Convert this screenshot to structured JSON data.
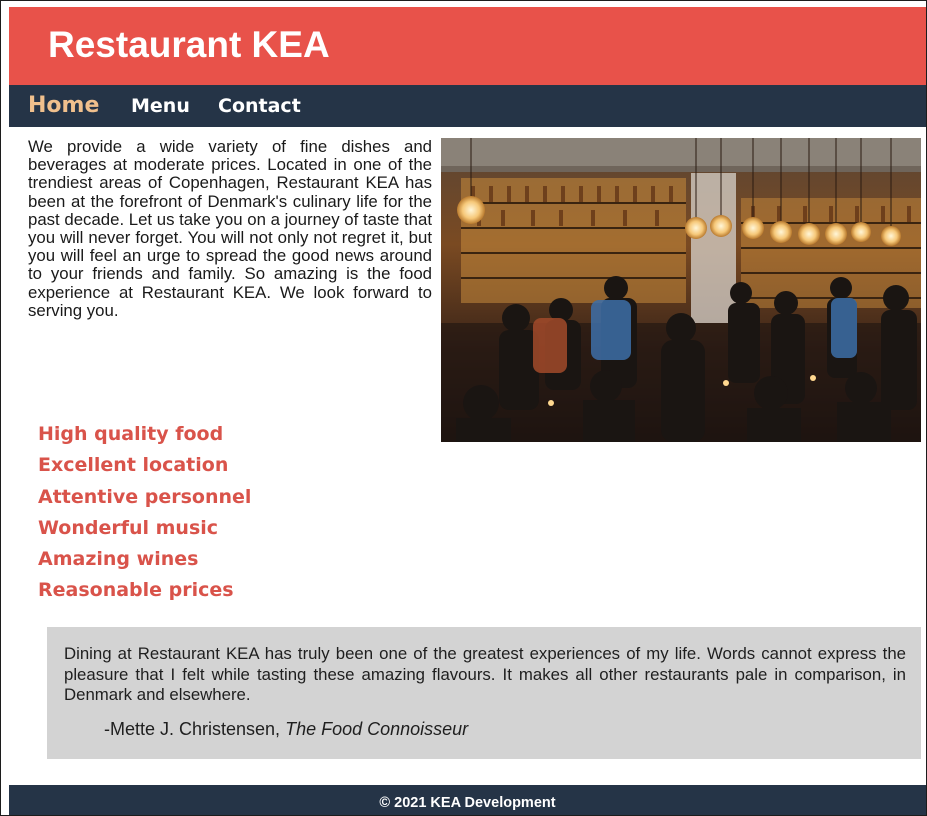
{
  "site": {
    "title": "Restaurant KEA"
  },
  "nav": {
    "items": [
      {
        "label": "Home"
      },
      {
        "label": "Menu"
      },
      {
        "label": "Contact"
      }
    ]
  },
  "intro": {
    "text": "We provide a wide variety of fine dishes and beverages at moderate prices. Located in one of the trendiest areas of Copenhagen, Restaurant KEA has been at the forefront of Denmark's culinary life for the past decade. Let us take you on a journey of taste that you will never forget. You will not only not regret it, but you will feel an urge to spread the good news around to your friends and family. So amazing is the food experience at Restaurant KEA. We look forward to serving you."
  },
  "features": [
    "High quality food",
    "Excellent location",
    "Attentive personnel",
    "Wonderful music",
    "Amazing wines",
    "Reasonable prices"
  ],
  "testimonial": {
    "text": "Dining at Restaurant KEA has truly been one of the greatest experiences of my life. Words cannot express the pleasure that I felt while tasting these amazing flavours. It makes all other restaurants pale in comparison, in Denmark and elsewhere.",
    "author": "-Mette J. Christensen,",
    "source": "The Food Connoisseur"
  },
  "footer": {
    "text": "© 2021 KEA Development"
  },
  "colors": {
    "header": "#e8524a",
    "nav": "#253447",
    "nav_active": "#f0c08d",
    "features": "#d9534a",
    "quote_bg": "#d3d3d3"
  }
}
